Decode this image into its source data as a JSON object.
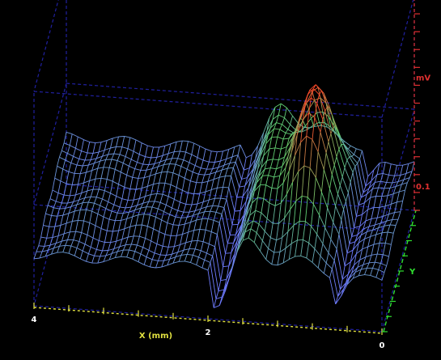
{
  "chart_data": {
    "type": "surface-3d-wireframe",
    "x_axis": {
      "label": "X (mm)",
      "ticks": [
        "4",
        "2",
        "0"
      ],
      "color": "#e0e040"
    },
    "y_axis": {
      "label": "Y",
      "color": "#30e030"
    },
    "z_axis": {
      "label": "mV",
      "ticks": [
        "123",
        "0.1"
      ],
      "color": "#e03030"
    },
    "z_range": [
      0.1,
      123
    ],
    "x_range": [
      4,
      0
    ],
    "grid_box": true,
    "surface": {
      "description_rows": 14,
      "baseline_level": 28,
      "ridge": {
        "x_mm": 1.55,
        "peak_mV": 58
      },
      "peak": {
        "x_mm": 1.0,
        "peak_mV": 100
      }
    },
    "colors": {
      "low": "#6f7cff",
      "mid": "#60d070",
      "high": "#ff4a2a",
      "box": "#2020a0"
    }
  }
}
